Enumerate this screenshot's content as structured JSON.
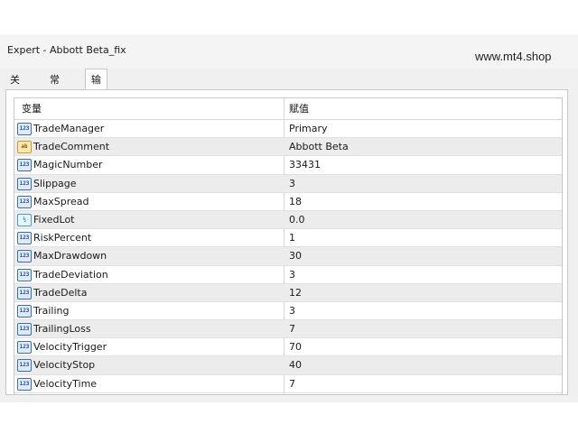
{
  "window": {
    "title": "Expert - Abbott Beta_fix"
  },
  "watermark": "www.mt4.shop",
  "tabs": [
    {
      "label": "关于"
    },
    {
      "label": "常用"
    },
    {
      "label": "输入参数"
    }
  ],
  "table": {
    "headers": {
      "name": "变量",
      "value": "赋值"
    },
    "rows": [
      {
        "name": "TradeManager",
        "value": "Primary",
        "type_icon": "123",
        "icon": "integer-type-icon"
      },
      {
        "name": "TradeComment",
        "value": "Abbott Beta",
        "type_icon": "ab",
        "icon": "string-type-icon"
      },
      {
        "name": "MagicNumber",
        "value": "33431",
        "type_icon": "123",
        "icon": "integer-type-icon"
      },
      {
        "name": "Slippage",
        "value": "3",
        "type_icon": "123",
        "icon": "integer-type-icon"
      },
      {
        "name": "MaxSpread",
        "value": "18",
        "type_icon": "123",
        "icon": "integer-type-icon"
      },
      {
        "name": "FixedLot",
        "value": "0.0",
        "type_icon": "½",
        "icon": "double-type-icon"
      },
      {
        "name": "RiskPercent",
        "value": "1",
        "type_icon": "123",
        "icon": "integer-type-icon"
      },
      {
        "name": "MaxDrawdown",
        "value": "30",
        "type_icon": "123",
        "icon": "integer-type-icon"
      },
      {
        "name": "TradeDeviation",
        "value": "3",
        "type_icon": "123",
        "icon": "integer-type-icon"
      },
      {
        "name": "TradeDelta",
        "value": "12",
        "type_icon": "123",
        "icon": "integer-type-icon"
      },
      {
        "name": "Trailing",
        "value": "3",
        "type_icon": "123",
        "icon": "integer-type-icon"
      },
      {
        "name": "TrailingLoss",
        "value": "7",
        "type_icon": "123",
        "icon": "integer-type-icon"
      },
      {
        "name": "VelocityTrigger",
        "value": "70",
        "type_icon": "123",
        "icon": "integer-type-icon"
      },
      {
        "name": "VelocityStop",
        "value": "40",
        "type_icon": "123",
        "icon": "integer-type-icon"
      },
      {
        "name": "VelocityTime",
        "value": "7",
        "type_icon": "123",
        "icon": "integer-type-icon"
      }
    ]
  }
}
